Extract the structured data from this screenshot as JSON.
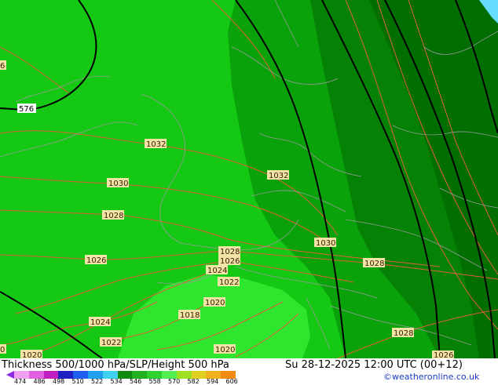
{
  "map": {
    "colors": {
      "field_light": "#2ee62e",
      "field_mid": "#14c814",
      "field_band": "#0aa20a",
      "field_dark": "#058205",
      "field_darkest": "#006e00",
      "isobar": "#e0603a",
      "border": "#9a9a9a",
      "height_contour": "#000000",
      "sea_edge": "#66ddff"
    },
    "pressure_labels": [
      {
        "id": "p1032a",
        "text": "1032"
      },
      {
        "id": "p1032b",
        "text": "1032"
      },
      {
        "id": "p1030a",
        "text": "1030"
      },
      {
        "id": "p1030b",
        "text": "1030"
      },
      {
        "id": "p1028a",
        "text": "1028"
      },
      {
        "id": "p1028b",
        "text": "1028"
      },
      {
        "id": "p1028c",
        "text": "1028"
      },
      {
        "id": "p1028d",
        "text": "1028"
      },
      {
        "id": "p1026a",
        "text": "1026"
      },
      {
        "id": "p1026b",
        "text": "1026"
      },
      {
        "id": "p1026c",
        "text": "1026"
      },
      {
        "id": "p1024a",
        "text": "1024"
      },
      {
        "id": "p1024b",
        "text": "1024"
      },
      {
        "id": "p1022a",
        "text": "1022"
      },
      {
        "id": "p1022b",
        "text": "1022"
      },
      {
        "id": "p1020a",
        "text": "1020"
      },
      {
        "id": "p1020b",
        "text": "1020"
      },
      {
        "id": "p1020c",
        "text": "1020"
      },
      {
        "id": "p1018",
        "text": "1018"
      },
      {
        "id": "pedge1",
        "text": "6"
      },
      {
        "id": "pedge2",
        "text": "0"
      }
    ],
    "height_labels": [
      {
        "id": "h576",
        "text": "576"
      }
    ]
  },
  "footer": {
    "title": "Thickness 500/1000 hPa/SLP/Height 500 hPa",
    "time": "Su 28-12-2025 12:00 UTC (00+12)",
    "credit": "©weatheronline.co.uk"
  },
  "legend": {
    "colors": [
      "#f0a0f0",
      "#e060e0",
      "#c020c0",
      "#2020c0",
      "#2060f0",
      "#20a0f0",
      "#40d0f0",
      "#108a10",
      "#20b020",
      "#30d030",
      "#50ee50",
      "#a0e020",
      "#e0d020",
      "#f0b020",
      "#f08a10"
    ],
    "ticks": [
      "474",
      "486",
      "498",
      "510",
      "522",
      "534",
      "546",
      "558",
      "570",
      "582",
      "594",
      "606"
    ]
  }
}
